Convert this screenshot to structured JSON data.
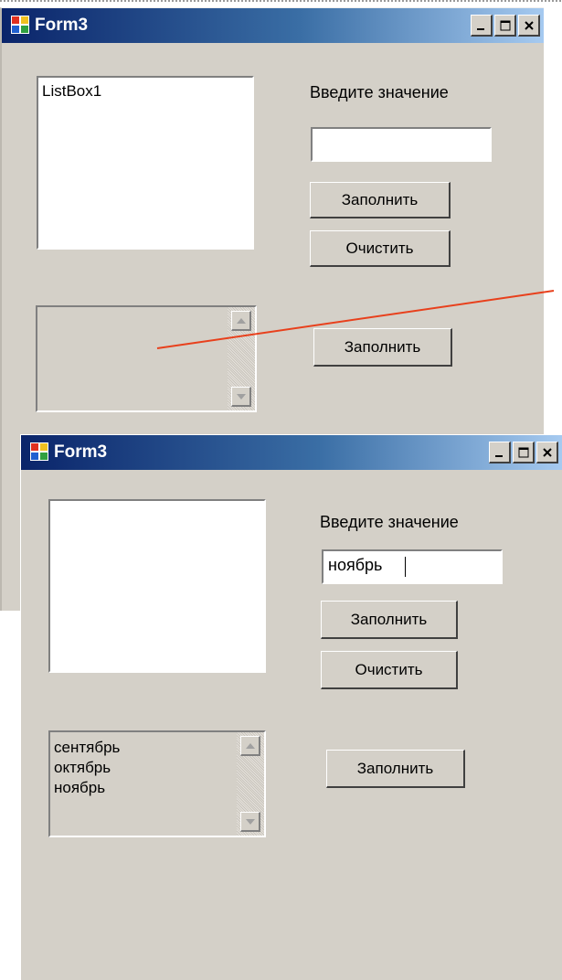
{
  "window_top": {
    "title": "Form3",
    "listbox1_text": "ListBox1",
    "prompt_label": "Введите значение",
    "input_value": "",
    "fill_button": "Заполнить",
    "clear_button": "Очистить",
    "fill_button_2": "Заполнить"
  },
  "window_bottom": {
    "title": "Form3",
    "prompt_label": "Введите значение",
    "input_value": "ноябрь",
    "fill_button": "Заполнить",
    "clear_button": "Очистить",
    "fill_button_2": "Заполнить",
    "list_items": [
      "сентябрь",
      "октябрь",
      "ноябрь"
    ]
  },
  "colors": {
    "face": "#d4d0c8",
    "title_start": "#0a246a",
    "title_end": "#a6caf0",
    "annotation_line": "#e8401c"
  }
}
